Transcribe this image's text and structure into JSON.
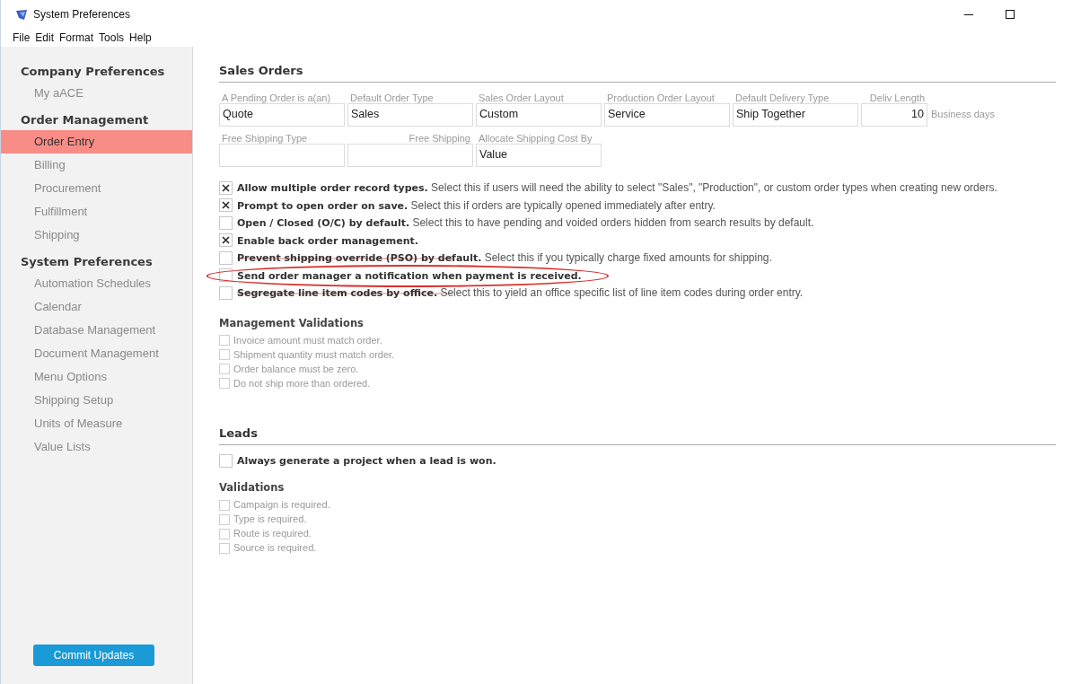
{
  "window": {
    "title": "System Preferences"
  },
  "menu": [
    "File",
    "Edit",
    "Format",
    "Tools",
    "Help"
  ],
  "sidebar": {
    "sections": [
      {
        "title": "Company Preferences",
        "items": [
          {
            "label": "My aACE",
            "selected": false
          }
        ]
      },
      {
        "title": "Order Management",
        "items": [
          {
            "label": "Order Entry",
            "selected": true
          },
          {
            "label": "Billing",
            "selected": false
          },
          {
            "label": "Procurement",
            "selected": false
          },
          {
            "label": "Fulfillment",
            "selected": false
          },
          {
            "label": "Shipping",
            "selected": false
          }
        ]
      },
      {
        "title": "System Preferences",
        "items": [
          {
            "label": "Automation Schedules",
            "selected": false
          },
          {
            "label": "Calendar",
            "selected": false
          },
          {
            "label": "Database Management",
            "selected": false
          },
          {
            "label": "Document Management",
            "selected": false
          },
          {
            "label": "Menu Options",
            "selected": false
          },
          {
            "label": "Shipping Setup",
            "selected": false
          },
          {
            "label": "Units of Measure",
            "selected": false
          },
          {
            "label": "Value Lists",
            "selected": false
          }
        ]
      }
    ],
    "button": "Commit Updates"
  },
  "sales_orders": {
    "title": "Sales Orders",
    "field_rows": [
      [
        {
          "label": "A Pending Order is a(an)",
          "value": "Quote",
          "numeric": false
        },
        {
          "label": "Default Order Type",
          "value": "Sales",
          "numeric": false
        },
        {
          "label": "Sales Order Layout",
          "value": "Custom",
          "numeric": false
        },
        {
          "label": "Production Order Layout",
          "value": "Service",
          "numeric": false
        },
        {
          "label": "Default Delivery Type",
          "value": "Ship Together",
          "numeric": false
        },
        {
          "label": "Deliv Length",
          "value": "10",
          "numeric": true,
          "suffix": "Business days"
        }
      ],
      [
        {
          "label": "Free Shipping Type",
          "numeric": false
        },
        {
          "label": "Free Shipping",
          "numeric": true
        },
        {
          "label": "Allocate Shipping Cost By",
          "value": "Value",
          "numeric": false
        }
      ]
    ],
    "options": [
      {
        "bold": "Allow multiple order record types.",
        "text": "Select this if users will need the ability to select \"Sales\", \"Production\", or custom order types when creating new orders.",
        "checked": true,
        "struck": false,
        "circled": false
      },
      {
        "bold": "Prompt to open order on save.",
        "text": "Select this if orders are typically opened immediately after entry.",
        "checked": true,
        "struck": false,
        "circled": false
      },
      {
        "bold": "Open / Closed (O/C) by default.",
        "text": "Select this to have pending and voided orders hidden from search results by default.",
        "checked": false,
        "struck": false,
        "circled": false
      },
      {
        "bold": "Enable back order management.",
        "checked": true,
        "struck": false,
        "circled": false
      },
      {
        "bold": "Prevent shipping override (PSO) by default.",
        "text": "Select this if you typically charge fixed amounts for shipping.",
        "checked": false,
        "struck": true,
        "circled": false
      },
      {
        "bold": "Send order manager a notification when payment is received.",
        "checked": false,
        "struck": false,
        "circled": true
      },
      {
        "bold": "Segregate line item codes by office.",
        "text": "Select this to yield an office specific list of line item codes during order entry.",
        "checked": false,
        "struck": true,
        "circled": false
      }
    ],
    "validations_title": "Management Validations",
    "validations": [
      {
        "label": "Invoice amount must match order.",
        "checked": false,
        "disabled": true
      },
      {
        "label": "Shipment quantity must match order.",
        "checked": false,
        "disabled": true
      },
      {
        "label": "Order balance must be zero.",
        "checked": false,
        "disabled": true
      },
      {
        "label": "Do not ship more than ordered.",
        "checked": false,
        "disabled": true
      }
    ]
  },
  "leads": {
    "title": "Leads",
    "options": [
      {
        "bold": "Always generate a project when a lead is won.",
        "checked": false,
        "struck": false,
        "circled": false
      }
    ],
    "validations_title": "Validations",
    "validations": [
      {
        "label": "Campaign is required.",
        "checked": false,
        "disabled": true
      },
      {
        "label": "Type is required.",
        "checked": false,
        "disabled": true
      },
      {
        "label": "Route is required.",
        "checked": false,
        "disabled": true
      },
      {
        "label": "Source is required.",
        "checked": false,
        "disabled": true
      }
    ]
  }
}
